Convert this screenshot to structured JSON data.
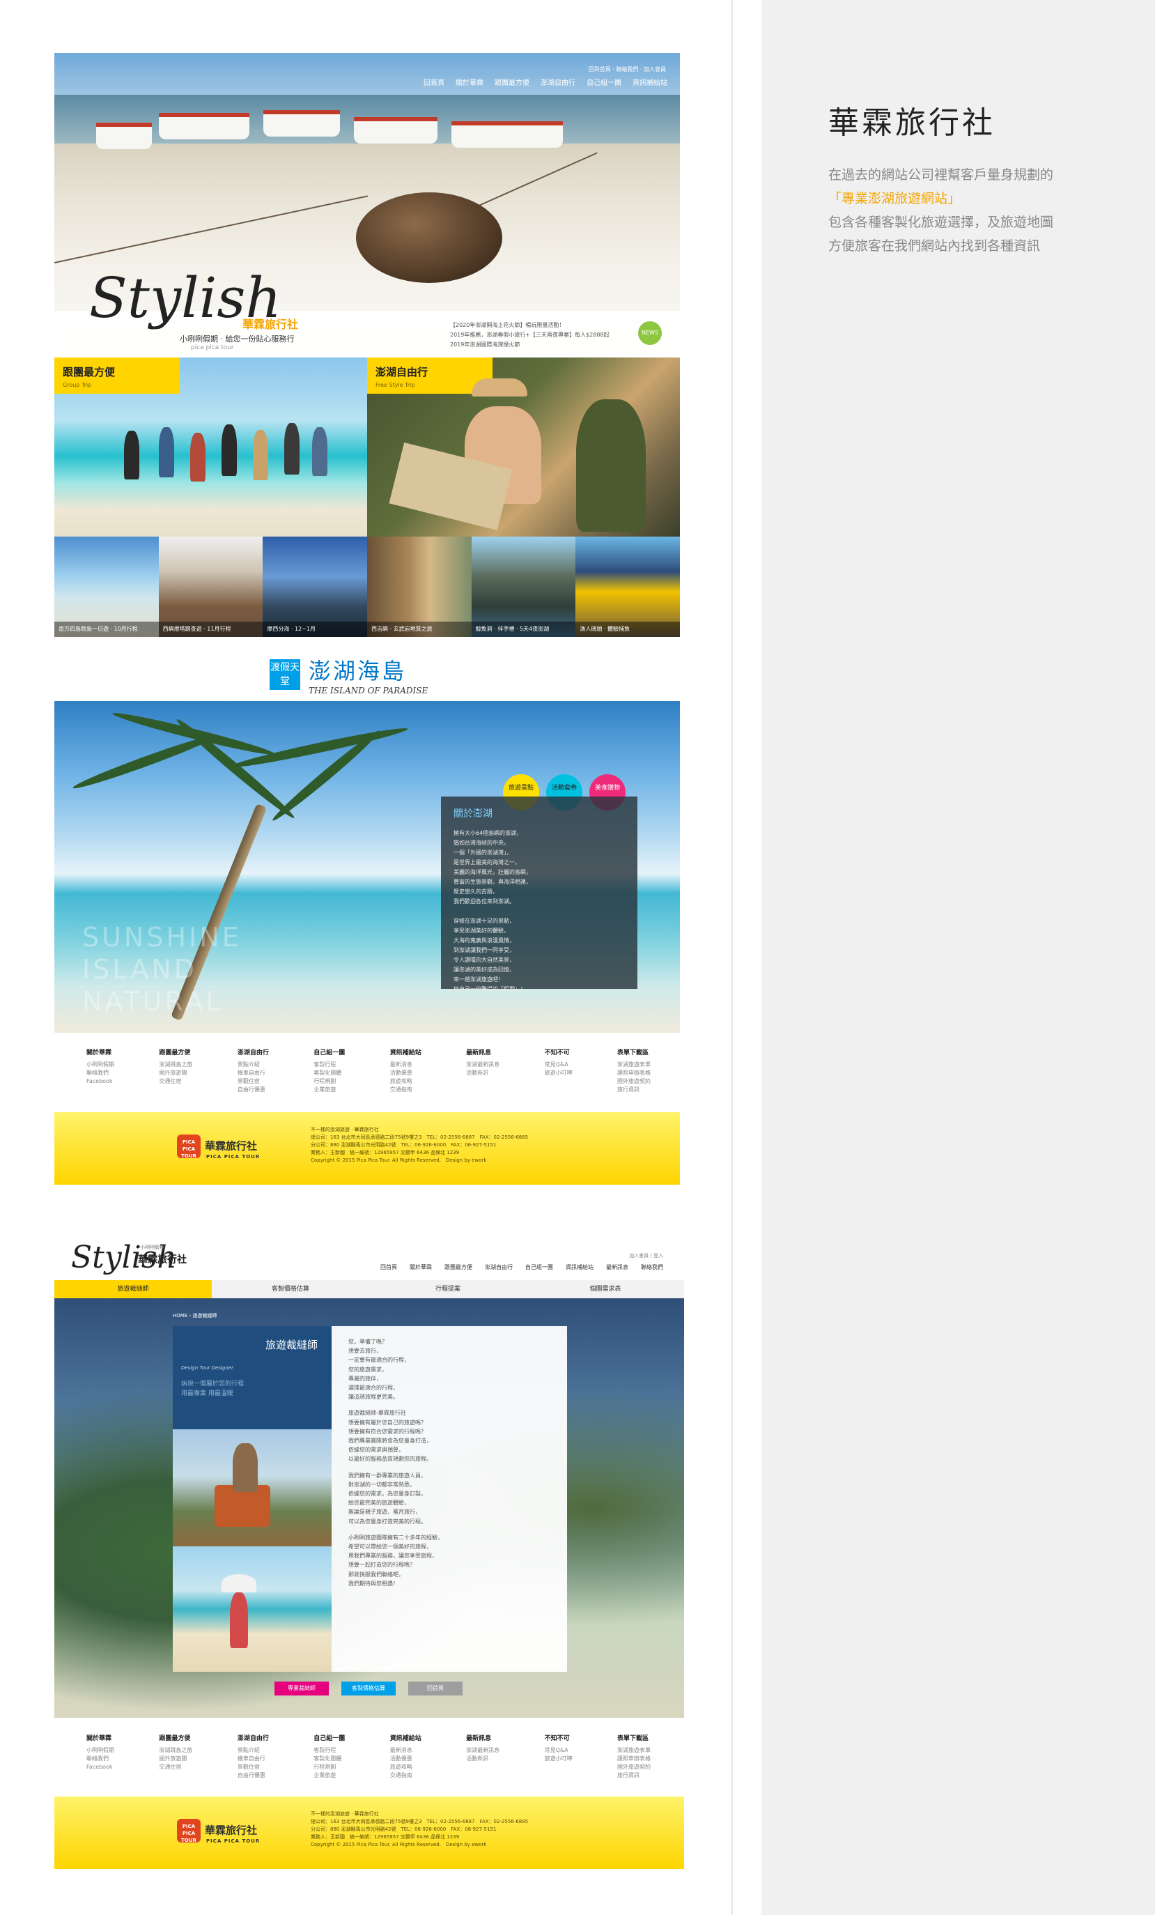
{
  "side": {
    "title": "華霖旅行社",
    "desc_1": "在過去的網站公司裡幫客戶量身規劃的",
    "highlight": "「專業澎湖旅遊網站」",
    "desc_2": "包含各種客製化旅遊選擇，及旅遊地圖",
    "desc_3": "方便旅客在我們網站內找到各種資訊"
  },
  "site1": {
    "top_links": "回到首頁 · 聯絡我們 · 加入會員",
    "nav": [
      "回首頁",
      "關於華霖",
      "跟團最方便",
      "澎湖自由行",
      "自己組一團",
      "資訊補給站"
    ],
    "logo_script": "Stylish",
    "brand": "華霖旅行社",
    "brand_prefix": "小咧咧假期",
    "brand_en": "pica pica tour",
    "brand_slogan": "給您一份貼心服務行",
    "news": [
      "【2020年澎湖開海上花火節】暢玩限量活動！",
      "2019年推薦，澎湖春假小旅行+【三天兩夜專案】每人$2888起",
      "2019年澎湖國際海灣煙火節"
    ],
    "news_badge": "NEWS",
    "group_title": "跟團最方便",
    "group_sub": "Group Trip",
    "free_title": "澎湖自由行",
    "free_sub": "Free Style Trip",
    "thumbs": [
      "南方四島跳島一日遊 · 10月行程",
      "西嶼燈塔踏查遊 · 11月行程",
      "摩西分海 · 12~1月",
      "西吉嶼 · 玄武岩地質之旅",
      "鯨魚洞 · 伴手禮 · 5天4夜澎湖",
      "漁人碼頭 · 體驗捕魚"
    ],
    "penghu_square": "渡假天堂",
    "penghu_title": "澎湖海島",
    "penghu_en": "THE ISLAND OF PARADISE",
    "bubbles": [
      "旅遊景點",
      "活動套券",
      "美食購物"
    ],
    "watermark": [
      "SUNSHINE",
      "ISLAND",
      "NATURAL"
    ],
    "about_title": "關於澎湖",
    "about_p1": [
      "擁有大小64個島嶼的澎湖，",
      "猶如台灣海峽的中央。",
      "一個「外國的澎湖灣」，",
      "是世界上最美的海灣之一，",
      "美麗的海洋風光，壯麗的島嶼，",
      "豐富的生態景觀，與海洋相連，",
      "歷史悠久的古蹟，",
      "我們歡迎各位來到澎湖。"
    ],
    "about_p2": [
      "穿梭在澎湖十足的景點，",
      "享受澎湖美好的體驗，",
      "大海的寬廣與浪漫風情，",
      "到澎湖讓我們一同享受，",
      "令人讚嘆的大自然美景，",
      "讓澎湖的美好成為回憶，",
      "來一趟澎湖旅遊吧！",
      "給自己一份難得的「假期」！"
    ],
    "footer_cols": [
      {
        "h": "關於華霖",
        "items": [
          "小咧咧假期",
          "聯絡我們",
          "Facebook"
        ]
      },
      {
        "h": "跟團最方便",
        "items": [
          "澎湖跳島之旅",
          "國外旅遊團",
          "交通住宿"
        ]
      },
      {
        "h": "澎湖自由行",
        "items": [
          "景點介紹",
          "機車自由行",
          "景觀住宿",
          "自由行優惠"
        ]
      },
      {
        "h": "自己組一團",
        "items": [
          "客製行程",
          "客製化團體",
          "行程規劃",
          "企業旅遊"
        ]
      },
      {
        "h": "資訊補給站",
        "items": [
          "最新消息",
          "活動優惠",
          "旅遊攻略",
          "交通指南"
        ]
      },
      {
        "h": "最新訊息",
        "items": [
          "澎湖最新訊息",
          "活動新訊"
        ]
      },
      {
        "h": "不知不可",
        "items": [
          "常見Q&A",
          "旅遊小叮嚀"
        ]
      },
      {
        "h": "表單下載區",
        "items": [
          "澎湖旅遊表單",
          "護照申辦表格",
          "國外旅遊契約",
          "旅行資訊"
        ]
      }
    ],
    "footer_brand": "華霖旅行社",
    "footer_brand_en": "PICA PICA TOUR",
    "footer_logo_text": "PICA PICA TOUR",
    "footer_info": [
      "不一樣的澎湖旅遊 · 華霖旅行社",
      "總公司：163 台北市大同區承德路二段75號9樓之3　TEL：02-2556-6887　FAX：02-2556-6885",
      "分公司：880 澎湖縣馬公市光明路42號　TEL：06-926-6000　FAX：06-927-5151",
      "業務人：王新國　統一編號：12965957 交觀甲 6436 品保北 1239",
      "Copyright © 2015 Pica Pica Tour. All Rights Reserved.　Design by ework"
    ]
  },
  "site2": {
    "logo_script": "Stylish",
    "brand_small": "小咧咧假期",
    "brand": "華霖旅行社",
    "top_link": "加入會員 | 登入",
    "nav": [
      "回首頁",
      "關於華霖",
      "跟團最方便",
      "澎湖自由行",
      "自己組一團",
      "資訊補給站",
      "最新訊息",
      "聯絡我們"
    ],
    "tabs": [
      "旅遊裁縫師",
      "客製價格估算",
      "行程提案",
      "個團需求表"
    ],
    "crumb": "HOME › 旅遊裁縫師",
    "card_title": "旅遊裁縫師",
    "card_en": "Design Tour Designer",
    "card_quote": [
      "訴說一個屬於您的行程",
      "用最專業 用最溫暖"
    ],
    "body_p1": [
      "您，準備了嗎？",
      "想要去旅行，",
      "一定要有最適合的行程，",
      "您的旅遊需求，",
      "專屬的旅伴，",
      "選擇最適合的行程，",
      "讓這趟旅程更完美。"
    ],
    "body_p2": [
      "旅遊裁縫師-華霖旅行社",
      "想要擁有屬於您自己的旅遊嗎？",
      "想要擁有符合您需求的行程嗎？",
      "我們專業團隊將會為您量身打造，",
      "依據您的需求與預算，",
      "以最好的服務品質規劃您的旅程。"
    ],
    "body_p3": [
      "我們擁有一群專業的旅遊人員，",
      "對澎湖的一切都非常熟悉，",
      "依據您的需求，為您量身訂製，",
      "給您最完美的旅遊體驗，",
      "無論是親子旅遊、蜜月旅行，",
      "可以為您量身打造完美的行程。"
    ],
    "body_p4": [
      "小咧咧旅遊團隊擁有二十多年的經驗，",
      "希望可以帶給您一個美好的旅程，",
      "用我們專業的服務，讓您享受旅程，",
      "想要一起打造您的行程嗎？",
      "那就快跟我們聯絡吧，",
      "我們期待與您相遇！"
    ],
    "btns": [
      "專業裁縫師",
      "客製價格估算",
      "回首頁"
    ],
    "btn_colors": [
      "#e6007e",
      "#00a0e9",
      "#9e9e9e"
    ]
  }
}
